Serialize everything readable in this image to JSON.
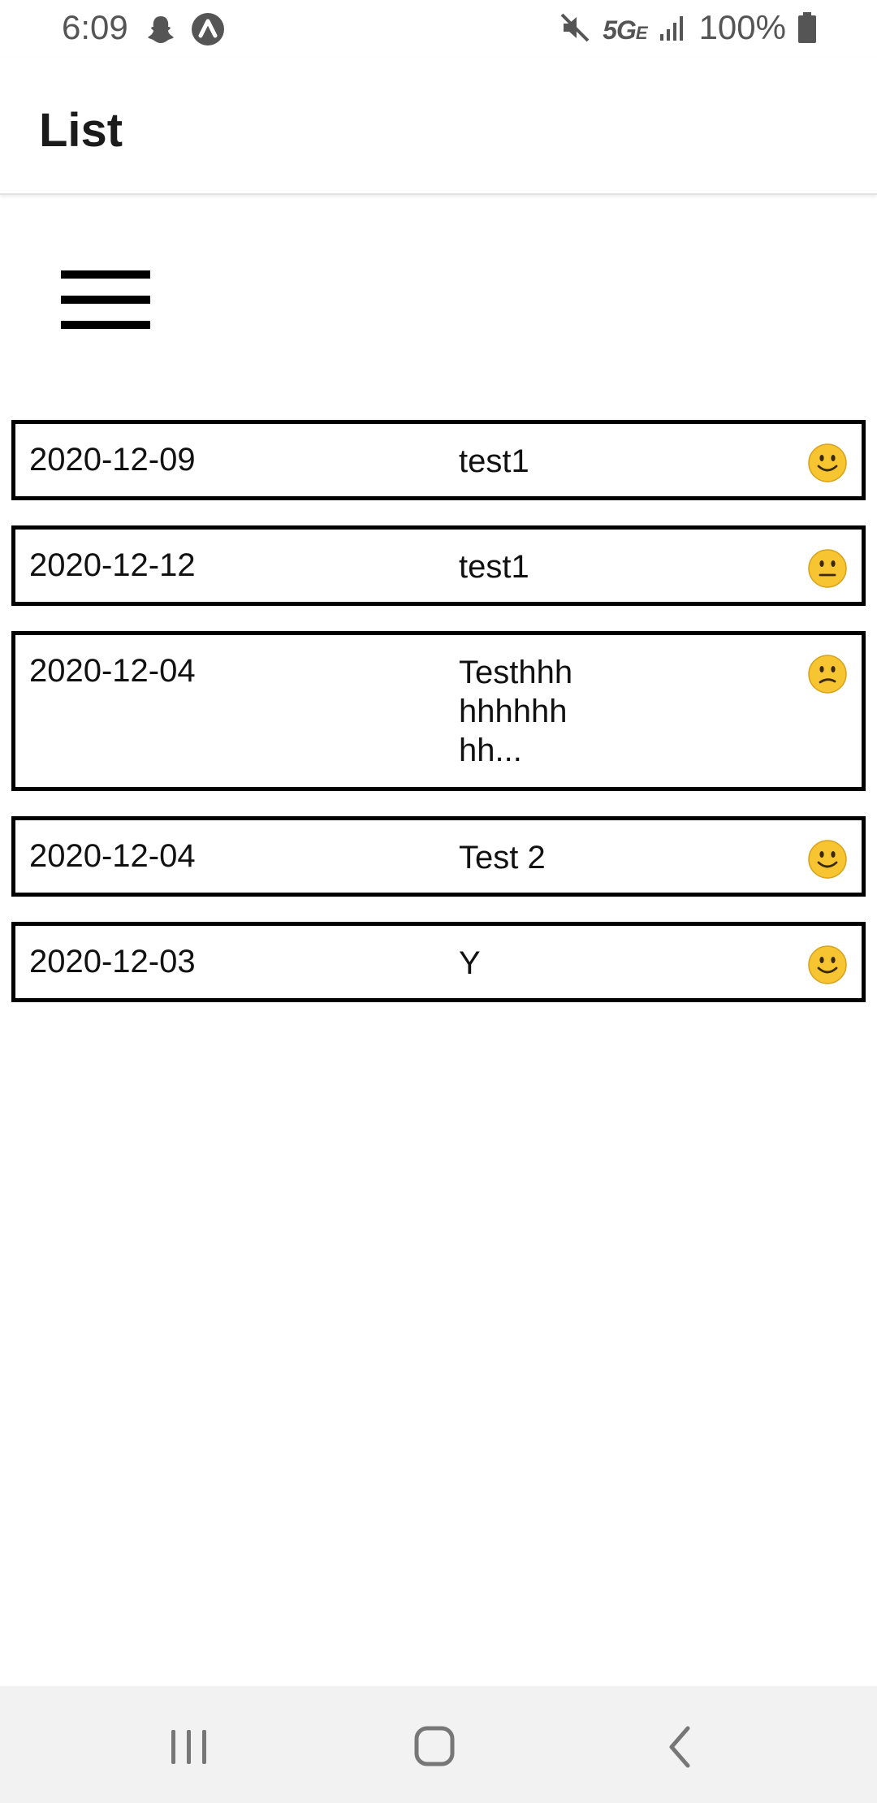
{
  "status_bar": {
    "time": "6:09",
    "network": "5G",
    "network_sub": "E",
    "battery": "100%",
    "icons": [
      "snapchat-icon",
      "notification-icon",
      "mute-icon",
      "signal-icon",
      "battery-icon"
    ]
  },
  "app_bar": {
    "title": "List"
  },
  "menu": {
    "icon": "hamburger-menu-icon"
  },
  "entries": [
    {
      "date": "2020-12-09",
      "title": "test1",
      "mood": "happy"
    },
    {
      "date": "2020-12-12",
      "title": "test1",
      "mood": "neutral"
    },
    {
      "date": "2020-12-04",
      "title": "Testhhh\nhhhhhh\nhh...",
      "mood": "sad"
    },
    {
      "date": "2020-12-04",
      "title": "Test 2",
      "mood": "happy"
    },
    {
      "date": "2020-12-03",
      "title": "Y",
      "mood": "happy"
    }
  ],
  "nav_bar": {
    "buttons": [
      "recent-apps",
      "home",
      "back"
    ]
  },
  "colors": {
    "border": "#000000",
    "emoji_face": "#F6C531",
    "nav_background": "#F2F2F2"
  }
}
